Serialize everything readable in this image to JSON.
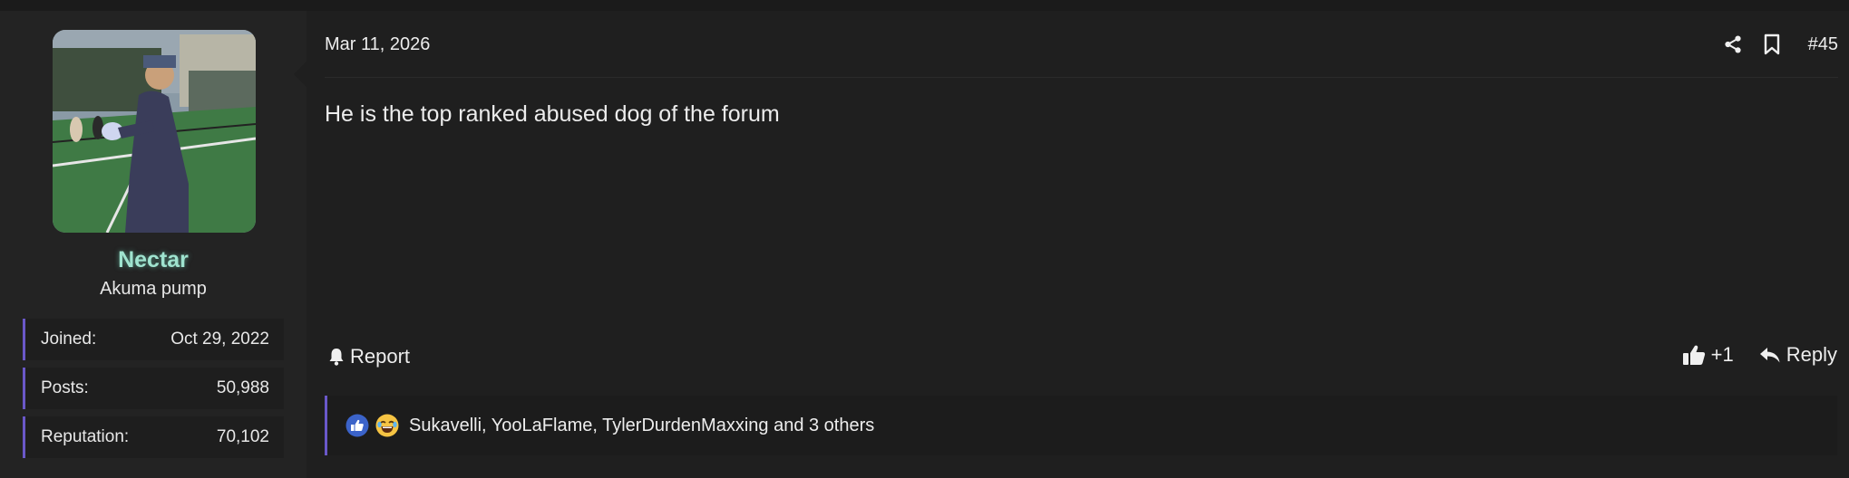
{
  "user": {
    "username": "Nectar",
    "user_title": "Akuma pump",
    "stats": [
      {
        "label": "Joined:",
        "value": "Oct 29, 2022"
      },
      {
        "label": "Posts:",
        "value": "50,988"
      },
      {
        "label": "Reputation:",
        "value": "70,102"
      }
    ]
  },
  "post": {
    "date": "Mar 11, 2026",
    "number": "#45",
    "message": "He is the top ranked abused dog of the forum",
    "report_label": "Report",
    "like_label": "+1",
    "reply_label": "Reply",
    "reactions_text": "Sukavelli, YooLaFlame, TylerDurdenMaxxing and 3 others"
  },
  "icons": {
    "share": "share-icon",
    "bookmark": "bookmark-icon",
    "bell": "bell-icon",
    "thumbs_up": "thumbs-up-icon",
    "reply": "reply-arrow-icon",
    "reaction_like": "like-reaction-icon",
    "reaction_laugh": "laughing-emoji-icon"
  },
  "colors": {
    "username": "#9fe3cf",
    "accent": "#6a58c9",
    "background": "#1f1f1f"
  }
}
